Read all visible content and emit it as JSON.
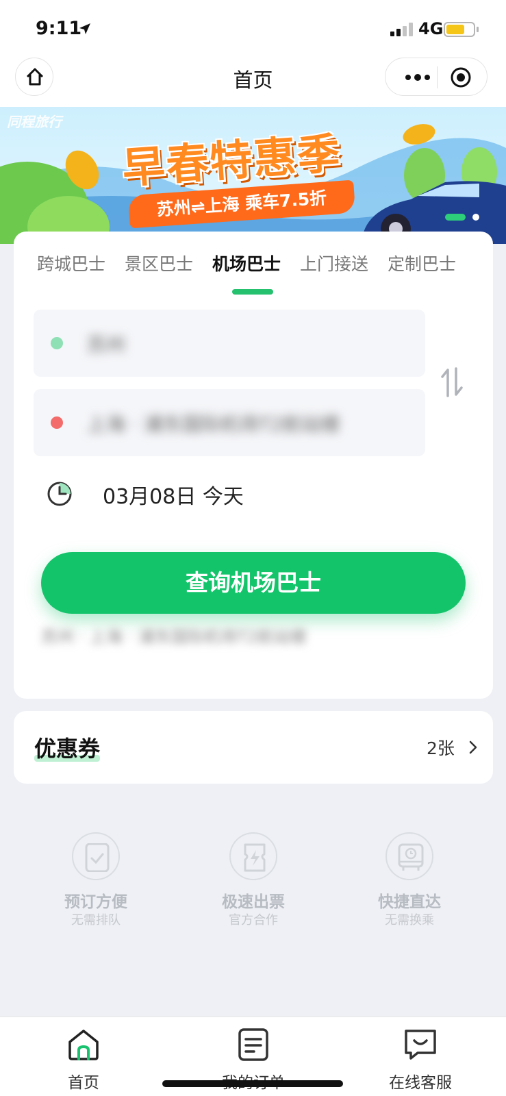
{
  "status_bar": {
    "time": "9:11",
    "network": "4G"
  },
  "nav": {
    "title": "首页"
  },
  "banner": {
    "brand": "同程旅行",
    "headline": "早春特惠季",
    "subline": "苏州⇌上海 乘车7.5折"
  },
  "tabs": [
    {
      "label": "跨城巴士",
      "active": false
    },
    {
      "label": "景区巴士",
      "active": false
    },
    {
      "label": "机场巴士",
      "active": true
    },
    {
      "label": "上门接送",
      "active": false
    },
    {
      "label": "定制巴士",
      "active": false
    }
  ],
  "search": {
    "from": "苏州",
    "to": "上海 · 浦东国际机场T2航站楼",
    "date": "03月08日 今天",
    "button_label": "查询机场巴士",
    "history": "苏州 · 上海 · 浦东国际机场T2航站楼"
  },
  "coupon": {
    "title": "优惠券",
    "count": "2张"
  },
  "features": [
    {
      "title": "预订方便",
      "subtitle": "无需排队",
      "icon": "phone-check-icon"
    },
    {
      "title": "极速出票",
      "subtitle": "官方合作",
      "icon": "ticket-lightning-icon"
    },
    {
      "title": "快捷直达",
      "subtitle": "无需换乘",
      "icon": "bus-clock-icon"
    }
  ],
  "tabbar": [
    {
      "label": "首页",
      "icon": "home-icon",
      "active": true
    },
    {
      "label": "我的订单",
      "icon": "order-list-icon",
      "active": false
    },
    {
      "label": "在线客服",
      "icon": "chat-icon",
      "active": false
    }
  ],
  "colors": {
    "accent": "#14c46b",
    "start_dot": "#8fe0b5",
    "end_dot": "#f36b6b",
    "banner_orange": "#ff6a1a"
  }
}
